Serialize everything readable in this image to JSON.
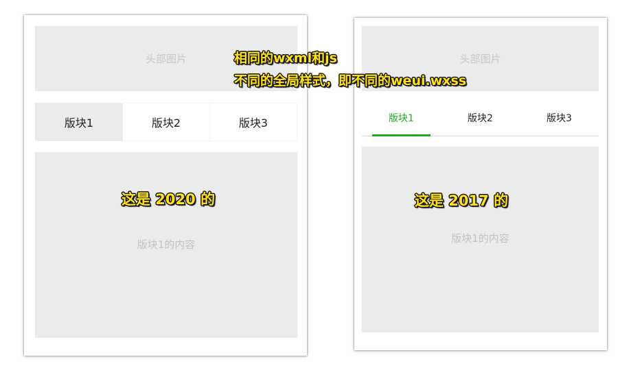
{
  "annotations": {
    "top_line1": "相同的wxml和js",
    "top_line2": "不同的全局样式，即不同的weui.wxss",
    "left_caption": "这是 2020 的",
    "right_caption": "这是 2017 的"
  },
  "left_card": {
    "header_placeholder": "头部图片",
    "tabs": [
      "版块1",
      "版块2",
      "版块3"
    ],
    "active_tab": 0,
    "content_text": "版块1的内容"
  },
  "right_card": {
    "header_placeholder": "头部图片",
    "tabs": [
      "版块1",
      "版块2",
      "版块3"
    ],
    "active_tab": 0,
    "content_text": "版块1的内容"
  },
  "colors": {
    "accent_green": "#1aad19",
    "placeholder_bg": "#ebebeb",
    "annotation_yellow": "#ffe21a"
  }
}
